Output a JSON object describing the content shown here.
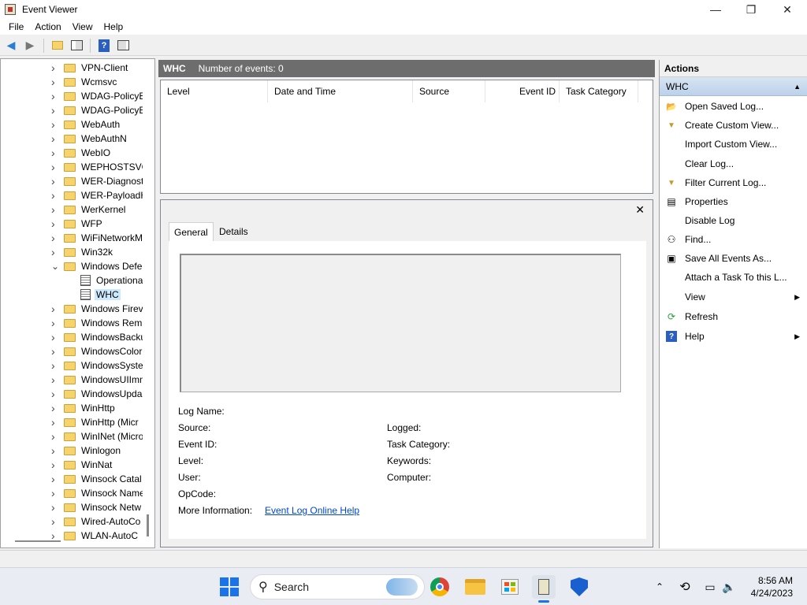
{
  "window": {
    "title": "Event Viewer",
    "minimize": "—",
    "maximize": "❐",
    "close": "✕"
  },
  "menu": [
    "File",
    "Action",
    "View",
    "Help"
  ],
  "tree": {
    "items": [
      {
        "label": "VPN-Client",
        "type": "folder",
        "expanded": false
      },
      {
        "label": "Wcmsvc",
        "type": "folder",
        "expanded": false
      },
      {
        "label": "WDAG-PolicyE",
        "type": "folder",
        "expanded": false
      },
      {
        "label": "WDAG-PolicyE",
        "type": "folder",
        "expanded": false
      },
      {
        "label": "WebAuth",
        "type": "folder",
        "expanded": false
      },
      {
        "label": "WebAuthN",
        "type": "folder",
        "expanded": false
      },
      {
        "label": "WebIO",
        "type": "folder",
        "expanded": false
      },
      {
        "label": "WEPHOSTSVC",
        "type": "folder",
        "expanded": false
      },
      {
        "label": "WER-Diagnost",
        "type": "folder",
        "expanded": false
      },
      {
        "label": "WER-PayloadH",
        "type": "folder",
        "expanded": false
      },
      {
        "label": "WerKernel",
        "type": "folder",
        "expanded": false
      },
      {
        "label": "WFP",
        "type": "folder",
        "expanded": false
      },
      {
        "label": "WiFiNetworkM",
        "type": "folder",
        "expanded": false
      },
      {
        "label": "Win32k",
        "type": "folder",
        "expanded": false
      },
      {
        "label": "Windows Defe",
        "type": "folder",
        "expanded": true
      },
      {
        "label": "Operationa",
        "type": "log"
      },
      {
        "label": "WHC",
        "type": "log",
        "selected": true
      },
      {
        "label": "Windows Firev",
        "type": "folder",
        "expanded": false
      },
      {
        "label": "Windows Rem",
        "type": "folder",
        "expanded": false
      },
      {
        "label": "WindowsBacku",
        "type": "folder",
        "expanded": false
      },
      {
        "label": "WindowsColor",
        "type": "folder",
        "expanded": false
      },
      {
        "label": "WindowsSyste",
        "type": "folder",
        "expanded": false
      },
      {
        "label": "WindowsUIImm",
        "type": "folder",
        "expanded": false
      },
      {
        "label": "WindowsUpda",
        "type": "folder",
        "expanded": false
      },
      {
        "label": "WinHttp",
        "type": "folder",
        "expanded": false
      },
      {
        "label": "WinHttp (Micr",
        "type": "folder",
        "expanded": false
      },
      {
        "label": "WinINet (Micro",
        "type": "folder",
        "expanded": false
      },
      {
        "label": "Winlogon",
        "type": "folder",
        "expanded": false
      },
      {
        "label": "WinNat",
        "type": "folder",
        "expanded": false
      },
      {
        "label": "Winsock Catal",
        "type": "folder",
        "expanded": false
      },
      {
        "label": "Winsock Name",
        "type": "folder",
        "expanded": false
      },
      {
        "label": "Winsock Netw",
        "type": "folder",
        "expanded": false
      },
      {
        "label": "Wired-AutoCo",
        "type": "folder",
        "expanded": false
      },
      {
        "label": "WLAN-AutoC",
        "type": "folder",
        "expanded": false
      }
    ]
  },
  "center": {
    "log_name": "WHC",
    "event_count": "Number of events: 0",
    "columns": [
      "Level",
      "Date and Time",
      "Source",
      "Event ID",
      "Task Category"
    ],
    "tabs": [
      "General",
      "Details"
    ],
    "fields_left": [
      "Log Name:",
      "Source:",
      "Event ID:",
      "Level:",
      "User:",
      "OpCode:",
      "More Information:"
    ],
    "fields_right": [
      "Logged:",
      "Task Category:",
      "Keywords:",
      "Computer:"
    ],
    "help_link": "Event Log Online Help",
    "close": "✕"
  },
  "actions": {
    "header": "Actions",
    "section": "WHC",
    "items": [
      {
        "label": "Open Saved Log...",
        "icon": "folder-open-icon",
        "glyph": "📂"
      },
      {
        "label": "Create Custom View...",
        "icon": "filter-icon",
        "glyph": "▼"
      },
      {
        "label": "Import Custom View...",
        "icon": "",
        "glyph": ""
      },
      {
        "label": "Clear Log...",
        "icon": "",
        "glyph": ""
      },
      {
        "label": "Filter Current Log...",
        "icon": "filter-icon",
        "glyph": "▼"
      },
      {
        "label": "Properties",
        "icon": "properties-icon",
        "glyph": "▤"
      },
      {
        "label": "Disable Log",
        "icon": "",
        "glyph": ""
      },
      {
        "label": "Find...",
        "icon": "binoculars-icon",
        "glyph": "⚇"
      },
      {
        "label": "Save All Events As...",
        "icon": "save-icon",
        "glyph": "▣"
      },
      {
        "label": "Attach a Task To this L...",
        "icon": "",
        "glyph": ""
      },
      {
        "label": "View",
        "icon": "",
        "glyph": "",
        "submenu": true
      },
      {
        "label": "Refresh",
        "icon": "refresh-icon",
        "glyph": "⟳"
      },
      {
        "label": "Help",
        "icon": "help-icon",
        "glyph": "?",
        "submenu": true
      }
    ]
  },
  "taskbar": {
    "search": "Search",
    "time": "8:56 AM",
    "date": "4/24/2023"
  }
}
